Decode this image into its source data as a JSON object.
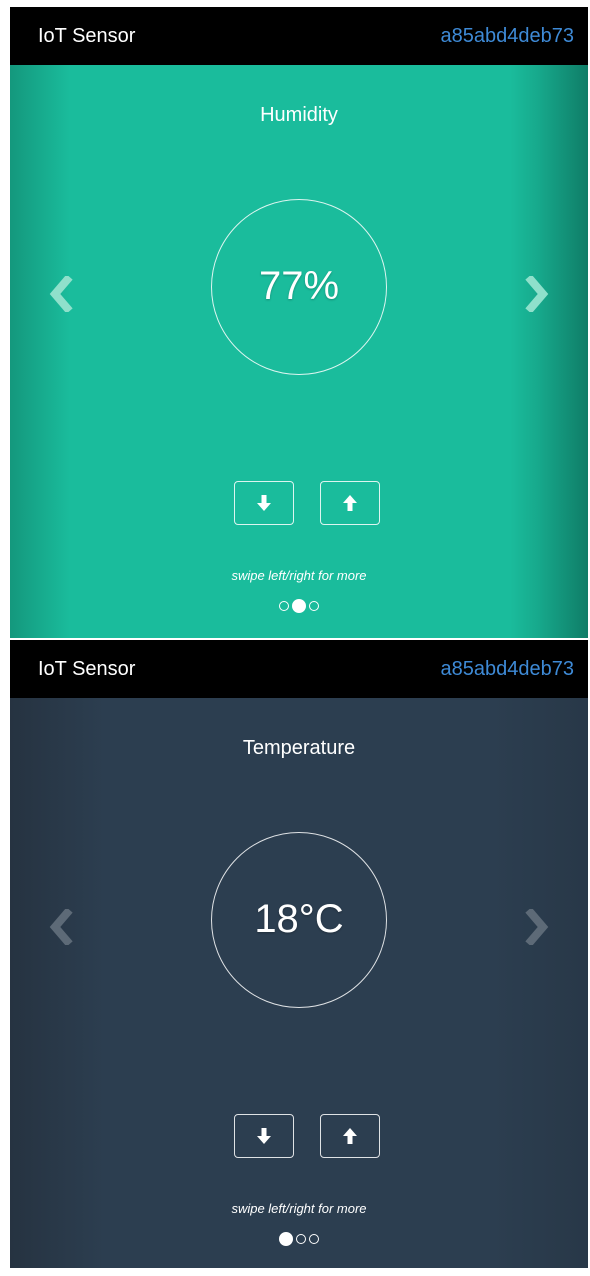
{
  "navbar": {
    "brand": "IoT Sensor",
    "device_id": "a85abd4deb73"
  },
  "slides": [
    {
      "title": "Humidity",
      "value": "77%",
      "hint": "swipe left/right for more",
      "active_indicator": 2,
      "indicator_count": 3,
      "background": "#1abc9c"
    },
    {
      "title": "Temperature",
      "value": "18°C",
      "hint": "swipe left/right for more",
      "active_indicator": 1,
      "indicator_count": 3,
      "background": "#2c3e50"
    }
  ],
  "icons": {
    "prev": "chevron-left-icon",
    "next": "chevron-right-icon",
    "decrease": "arrow-down-icon",
    "increase": "arrow-up-icon"
  },
  "colors": {
    "navbar_bg": "#000000",
    "device_id_link": "#3e8ad6",
    "text": "#ffffff"
  }
}
